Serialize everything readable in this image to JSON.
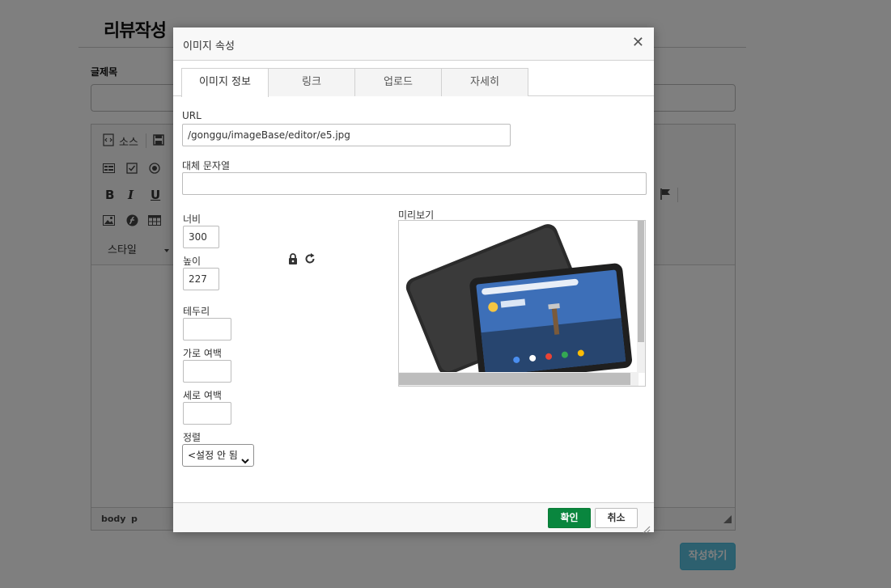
{
  "page": {
    "title": "리뷰작성",
    "subject_label": "글제목",
    "write_button": "작성하기",
    "toolbar": {
      "source": "소스",
      "style": "스타일"
    },
    "path": {
      "body": "body",
      "p": "p"
    }
  },
  "dialog": {
    "title": "이미지 속성",
    "tabs": [
      {
        "label": "이미지 정보",
        "active": true
      },
      {
        "label": "링크",
        "active": false
      },
      {
        "label": "업로드",
        "active": false
      },
      {
        "label": "자세히",
        "active": false
      }
    ],
    "url_label": "URL",
    "url_value": "/gonggu/imageBase/editor/e5.jpg",
    "alt_label": "대체 문자열",
    "alt_value": "",
    "width_label": "너비",
    "width_value": "300",
    "height_label": "높이",
    "height_value": "227",
    "border_label": "테두리",
    "border_value": "",
    "hspace_label": "가로 여백",
    "hspace_value": "",
    "vspace_label": "세로 여백",
    "vspace_value": "",
    "align_label": "정렬",
    "align_selected": "<설정 안 됨>",
    "preview_label": "미리보기",
    "ok_button": "확인",
    "cancel_button": "취소"
  },
  "icons": {
    "close": "close-icon",
    "lock": "lock-icon",
    "reset": "reset-size-icon"
  },
  "colors": {
    "ok_button": "#09863e",
    "write_button": "#5bc0de"
  }
}
